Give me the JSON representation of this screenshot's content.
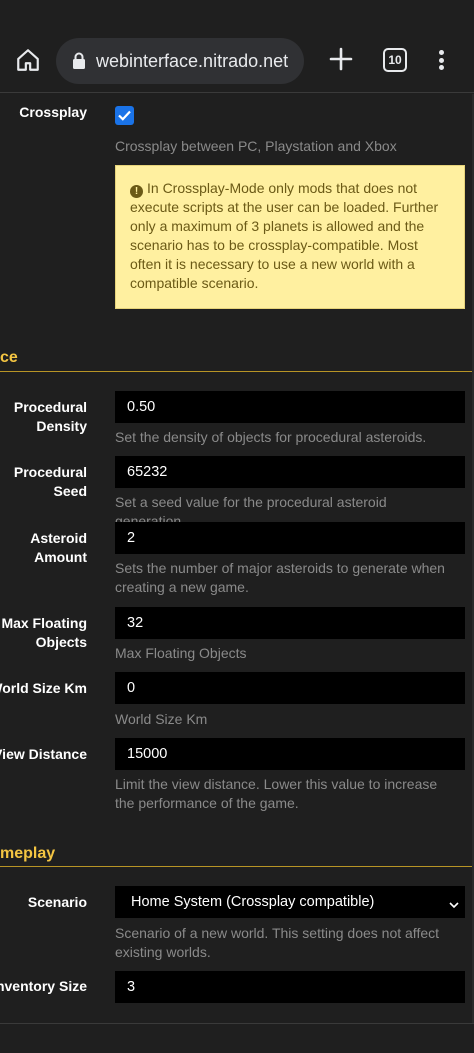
{
  "browser": {
    "url": "webinterface.nitrado.net",
    "tab_count": "10"
  },
  "crossplay": {
    "label": "Crossplay",
    "checked": true,
    "help": "Crossplay between PC, Playstation and Xbox",
    "warning": "In Crossplay-Mode only mods that does not execute scripts at the user can be loaded. Further only a maximum of 3 planets is allowed and the scenario has to be crossplay-compatible. Most often it is necessary to use a new world with a compatible scenario."
  },
  "sections": {
    "space_title": "ce",
    "gameplay_title": "meplay"
  },
  "fields": {
    "procedural_density": {
      "label_1": "Procedural",
      "label_2": "Density",
      "value": "0.50",
      "help": "Set the density of objects for procedural asteroids."
    },
    "procedural_seed": {
      "label_1": "Procedural",
      "label_2": "Seed",
      "value": "65232",
      "help": "Set a seed value for the procedural asteroid generation."
    },
    "asteroid_amount": {
      "label_1": "Asteroid",
      "label_2": "Amount",
      "value": "2",
      "help": "Sets the number of major asteroids to generate when creating a new game."
    },
    "max_floating_objects": {
      "label_1": "Max Floating",
      "label_2": "Objects",
      "value": "32",
      "help": "Max Floating Objects"
    },
    "world_size": {
      "label": "World Size Km",
      "value": "0",
      "help": "World Size Km"
    },
    "view_distance": {
      "label": "View Distance",
      "value": "15000",
      "help": "Limit the view distance. Lower this value to increase the performance of the game."
    },
    "scenario": {
      "label": "Scenario",
      "value": "Home System (Crossplay compatible)",
      "help": "Scenario of a new world. This setting does not affect existing worlds."
    },
    "inventory_size": {
      "label": "Inventory Size",
      "value": "3"
    }
  },
  "colors": {
    "accent": "#f4c542",
    "checkbox": "#1a73e8",
    "warning_bg": "#fff0a0"
  }
}
